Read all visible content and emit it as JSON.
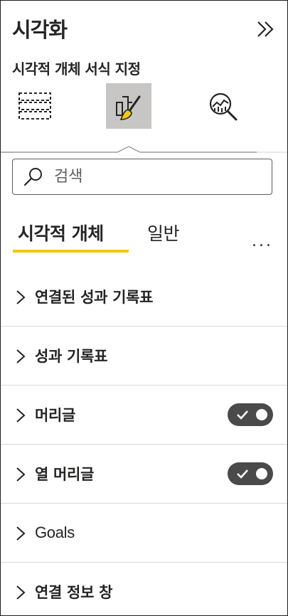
{
  "pane": {
    "title": "시각화",
    "subtitle": "시각적 개체 서식 지정"
  },
  "icons": {
    "collapse": "double-chevron-right-icon",
    "build": "fields-table-icon",
    "format": "paintbrush-icon",
    "analytics": "analytics-magnifier-icon"
  },
  "search": {
    "placeholder": "검색",
    "value": ""
  },
  "tabs": [
    {
      "label": "시각적 개체",
      "active": true
    },
    {
      "label": "일반",
      "active": false
    }
  ],
  "more_label": "...",
  "cards": [
    {
      "label": "연결된 성과 기록표",
      "has_toggle": false
    },
    {
      "label": "성과 기록표",
      "has_toggle": false
    },
    {
      "label": "머리글",
      "has_toggle": true,
      "toggle_on": true
    },
    {
      "label": "열 머리글",
      "has_toggle": true,
      "toggle_on": true
    },
    {
      "label": "Goals",
      "has_toggle": false
    },
    {
      "label": "연결 정보 창",
      "has_toggle": false
    }
  ],
  "colors": {
    "accent": "#f2c811",
    "active_icon_bg": "#c8c6c4",
    "toggle_bg": "#4a4a4a",
    "text": "#252423"
  }
}
